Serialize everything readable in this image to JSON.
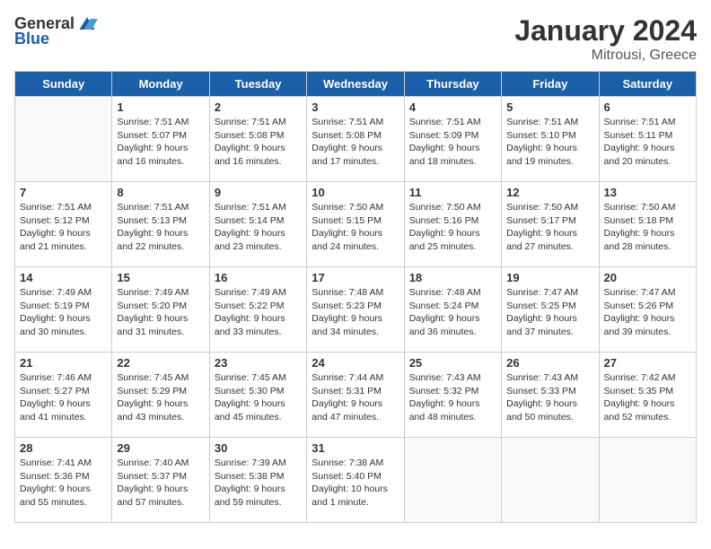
{
  "logo": {
    "general": "General",
    "blue": "Blue"
  },
  "title": "January 2024",
  "subtitle": "Mitrousi, Greece",
  "headers": [
    "Sunday",
    "Monday",
    "Tuesday",
    "Wednesday",
    "Thursday",
    "Friday",
    "Saturday"
  ],
  "weeks": [
    [
      {
        "day": "",
        "sunrise": "",
        "sunset": "",
        "daylight": ""
      },
      {
        "day": "1",
        "sunrise": "Sunrise: 7:51 AM",
        "sunset": "Sunset: 5:07 PM",
        "daylight": "Daylight: 9 hours and 16 minutes."
      },
      {
        "day": "2",
        "sunrise": "Sunrise: 7:51 AM",
        "sunset": "Sunset: 5:08 PM",
        "daylight": "Daylight: 9 hours and 16 minutes."
      },
      {
        "day": "3",
        "sunrise": "Sunrise: 7:51 AM",
        "sunset": "Sunset: 5:08 PM",
        "daylight": "Daylight: 9 hours and 17 minutes."
      },
      {
        "day": "4",
        "sunrise": "Sunrise: 7:51 AM",
        "sunset": "Sunset: 5:09 PM",
        "daylight": "Daylight: 9 hours and 18 minutes."
      },
      {
        "day": "5",
        "sunrise": "Sunrise: 7:51 AM",
        "sunset": "Sunset: 5:10 PM",
        "daylight": "Daylight: 9 hours and 19 minutes."
      },
      {
        "day": "6",
        "sunrise": "Sunrise: 7:51 AM",
        "sunset": "Sunset: 5:11 PM",
        "daylight": "Daylight: 9 hours and 20 minutes."
      }
    ],
    [
      {
        "day": "7",
        "sunrise": "Sunrise: 7:51 AM",
        "sunset": "Sunset: 5:12 PM",
        "daylight": "Daylight: 9 hours and 21 minutes."
      },
      {
        "day": "8",
        "sunrise": "Sunrise: 7:51 AM",
        "sunset": "Sunset: 5:13 PM",
        "daylight": "Daylight: 9 hours and 22 minutes."
      },
      {
        "day": "9",
        "sunrise": "Sunrise: 7:51 AM",
        "sunset": "Sunset: 5:14 PM",
        "daylight": "Daylight: 9 hours and 23 minutes."
      },
      {
        "day": "10",
        "sunrise": "Sunrise: 7:50 AM",
        "sunset": "Sunset: 5:15 PM",
        "daylight": "Daylight: 9 hours and 24 minutes."
      },
      {
        "day": "11",
        "sunrise": "Sunrise: 7:50 AM",
        "sunset": "Sunset: 5:16 PM",
        "daylight": "Daylight: 9 hours and 25 minutes."
      },
      {
        "day": "12",
        "sunrise": "Sunrise: 7:50 AM",
        "sunset": "Sunset: 5:17 PM",
        "daylight": "Daylight: 9 hours and 27 minutes."
      },
      {
        "day": "13",
        "sunrise": "Sunrise: 7:50 AM",
        "sunset": "Sunset: 5:18 PM",
        "daylight": "Daylight: 9 hours and 28 minutes."
      }
    ],
    [
      {
        "day": "14",
        "sunrise": "Sunrise: 7:49 AM",
        "sunset": "Sunset: 5:19 PM",
        "daylight": "Daylight: 9 hours and 30 minutes."
      },
      {
        "day": "15",
        "sunrise": "Sunrise: 7:49 AM",
        "sunset": "Sunset: 5:20 PM",
        "daylight": "Daylight: 9 hours and 31 minutes."
      },
      {
        "day": "16",
        "sunrise": "Sunrise: 7:49 AM",
        "sunset": "Sunset: 5:22 PM",
        "daylight": "Daylight: 9 hours and 33 minutes."
      },
      {
        "day": "17",
        "sunrise": "Sunrise: 7:48 AM",
        "sunset": "Sunset: 5:23 PM",
        "daylight": "Daylight: 9 hours and 34 minutes."
      },
      {
        "day": "18",
        "sunrise": "Sunrise: 7:48 AM",
        "sunset": "Sunset: 5:24 PM",
        "daylight": "Daylight: 9 hours and 36 minutes."
      },
      {
        "day": "19",
        "sunrise": "Sunrise: 7:47 AM",
        "sunset": "Sunset: 5:25 PM",
        "daylight": "Daylight: 9 hours and 37 minutes."
      },
      {
        "day": "20",
        "sunrise": "Sunrise: 7:47 AM",
        "sunset": "Sunset: 5:26 PM",
        "daylight": "Daylight: 9 hours and 39 minutes."
      }
    ],
    [
      {
        "day": "21",
        "sunrise": "Sunrise: 7:46 AM",
        "sunset": "Sunset: 5:27 PM",
        "daylight": "Daylight: 9 hours and 41 minutes."
      },
      {
        "day": "22",
        "sunrise": "Sunrise: 7:45 AM",
        "sunset": "Sunset: 5:29 PM",
        "daylight": "Daylight: 9 hours and 43 minutes."
      },
      {
        "day": "23",
        "sunrise": "Sunrise: 7:45 AM",
        "sunset": "Sunset: 5:30 PM",
        "daylight": "Daylight: 9 hours and 45 minutes."
      },
      {
        "day": "24",
        "sunrise": "Sunrise: 7:44 AM",
        "sunset": "Sunset: 5:31 PM",
        "daylight": "Daylight: 9 hours and 47 minutes."
      },
      {
        "day": "25",
        "sunrise": "Sunrise: 7:43 AM",
        "sunset": "Sunset: 5:32 PM",
        "daylight": "Daylight: 9 hours and 48 minutes."
      },
      {
        "day": "26",
        "sunrise": "Sunrise: 7:43 AM",
        "sunset": "Sunset: 5:33 PM",
        "daylight": "Daylight: 9 hours and 50 minutes."
      },
      {
        "day": "27",
        "sunrise": "Sunrise: 7:42 AM",
        "sunset": "Sunset: 5:35 PM",
        "daylight": "Daylight: 9 hours and 52 minutes."
      }
    ],
    [
      {
        "day": "28",
        "sunrise": "Sunrise: 7:41 AM",
        "sunset": "Sunset: 5:36 PM",
        "daylight": "Daylight: 9 hours and 55 minutes."
      },
      {
        "day": "29",
        "sunrise": "Sunrise: 7:40 AM",
        "sunset": "Sunset: 5:37 PM",
        "daylight": "Daylight: 9 hours and 57 minutes."
      },
      {
        "day": "30",
        "sunrise": "Sunrise: 7:39 AM",
        "sunset": "Sunset: 5:38 PM",
        "daylight": "Daylight: 9 hours and 59 minutes."
      },
      {
        "day": "31",
        "sunrise": "Sunrise: 7:38 AM",
        "sunset": "Sunset: 5:40 PM",
        "daylight": "Daylight: 10 hours and 1 minute."
      },
      {
        "day": "",
        "sunrise": "",
        "sunset": "",
        "daylight": ""
      },
      {
        "day": "",
        "sunrise": "",
        "sunset": "",
        "daylight": ""
      },
      {
        "day": "",
        "sunrise": "",
        "sunset": "",
        "daylight": ""
      }
    ]
  ]
}
